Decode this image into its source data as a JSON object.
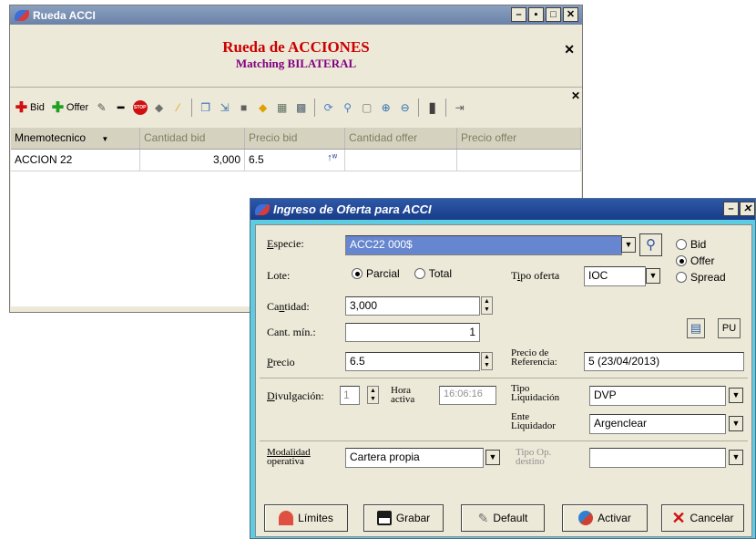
{
  "main_window": {
    "title": "Rueda ACCI",
    "header_title": "Rueda de ACCIONES",
    "header_subtitle": "Matching BILATERAL",
    "toolbar": {
      "bid_label": "Bid",
      "offer_label": "Offer"
    },
    "grid": {
      "columns": [
        "Mnemotecnico",
        "Cantidad bid",
        "Precio bid",
        "Cantidad offer",
        "Precio offer"
      ],
      "rows": [
        [
          "ACCION 22",
          "3,000",
          "6.5",
          "",
          ""
        ]
      ]
    }
  },
  "dialog": {
    "title": "Ingreso de Oferta para ACCI",
    "especie_label": "Especie:",
    "especie_value": "ACC22   000$",
    "side_options": [
      "Bid",
      "Offer",
      "Spread"
    ],
    "side_selected": "Offer",
    "lote_label": "Lote:",
    "lote_options": [
      "Parcial",
      "Total"
    ],
    "lote_selected": "Parcial",
    "tipo_oferta_label": "Tipo oferta",
    "tipo_oferta_value": "IOC",
    "cantidad_label": "Cantidad:",
    "cantidad_value": "3,000",
    "cant_min_label": "Cant. mín.:",
    "cant_min_value": "1",
    "pu_label": "PU",
    "precio_label": "Precio",
    "precio_value": "6.5",
    "precio_ref_label_1": "Precio de",
    "precio_ref_label_2": "Referencia:",
    "precio_ref_value": "5 (23/04/2013)",
    "divulgacion_label": "Divulgación:",
    "divulgacion_value": "1",
    "hora_label_1": "Hora",
    "hora_label_2": "activa",
    "hora_value": "16:06:16",
    "tipo_liq_label_1": "Tipo",
    "tipo_liq_label_2": "Liquidación",
    "tipo_liq_value": "DVP",
    "ente_label_1": "Ente",
    "ente_label_2": "Liquidador",
    "ente_value": "Argenclear",
    "modalidad_label_1": "Modalidad",
    "modalidad_label_2": "operativa",
    "modalidad_value": "Cartera propia",
    "tipo_op_label_1": "Tipo Op.",
    "tipo_op_label_2": "destino",
    "tipo_op_value": "",
    "buttons": {
      "limites": "Límites",
      "grabar": "Grabar",
      "default": "Default",
      "activar": "Activar",
      "cancelar": "Cancelar"
    }
  }
}
